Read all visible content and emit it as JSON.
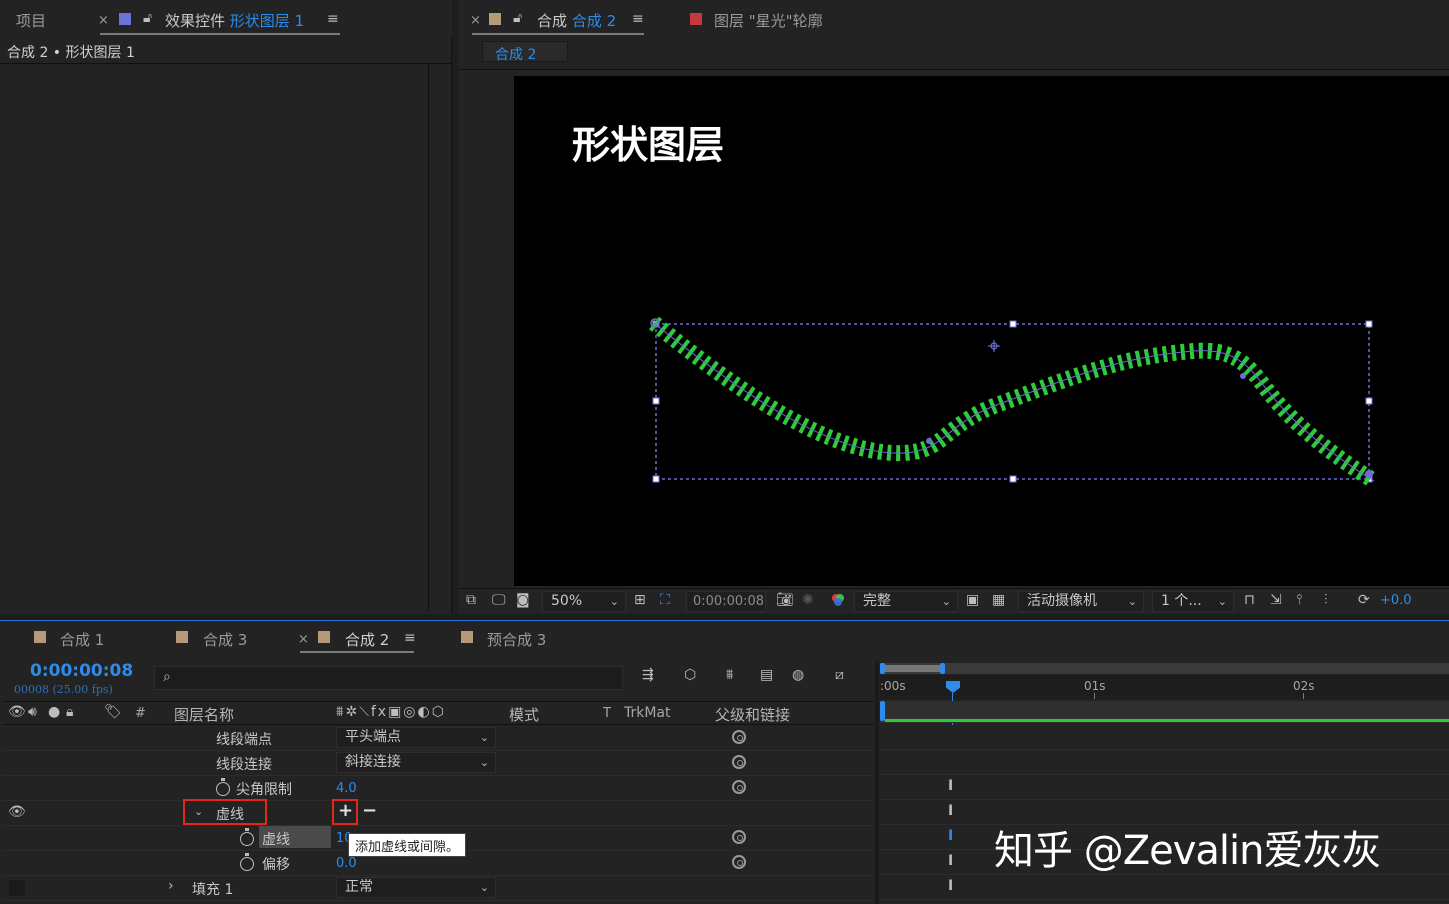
{
  "project_panel": {
    "tab_project": "项目",
    "tab_effects_prefix": "效果控件",
    "tab_effects_layer": "形状图层 1",
    "breadcrumb": "合成 2 • 形状图层 1"
  },
  "viewer_panel": {
    "tab_comp_prefix": "合成",
    "tab_comp_name": "合成 2",
    "tab_layer": "图层 \"星光\"轮廓",
    "sub_tab": "合成 2",
    "canvas_title": "形状图层",
    "toolbar": {
      "zoom": "50%",
      "timecode": "0:00:00:08",
      "resolution": "完整",
      "camera": "活动摄像机",
      "views": "1 个...",
      "exposure": "+0.0"
    }
  },
  "timeline": {
    "tabs": [
      {
        "label": "合成 1",
        "color": "#b59a7a"
      },
      {
        "label": "合成 3",
        "color": "#b59a7a"
      },
      {
        "label": "合成 2",
        "color": "#b59a7a"
      },
      {
        "label": "预合成 3",
        "color": "#b59a7a"
      }
    ],
    "current_time": "0:00:00:08",
    "frame_info": "00008 (25.00 fps)",
    "columns": {
      "hash": "#",
      "layer_name": "图层名称",
      "mode": "模式",
      "t": "T",
      "trkmat": "TrkMat",
      "parent": "父级和链接"
    },
    "ruler": {
      "t0": ":00s",
      "t1": "01s",
      "t2": "02s"
    },
    "rows": {
      "line_cap": {
        "label": "线段端点",
        "value": "平头端点"
      },
      "line_join": {
        "label": "线段连接",
        "value": "斜接连接"
      },
      "miter_limit": {
        "label": "尖角限制",
        "value": "4.0"
      },
      "dashes": {
        "label": "虚线"
      },
      "dash": {
        "label": "虚线",
        "value": "10"
      },
      "offset": {
        "label": "偏移",
        "value": "0.0"
      },
      "fill": {
        "label": "填充 1",
        "value": "正常"
      }
    },
    "tooltip": "添加虚线或间隙。"
  },
  "watermark": "知乎 @Zevalin爱灰灰",
  "colors": {
    "accent_blue": "#2d8ceb",
    "stroke_green": "#2ecb3a",
    "highlight_red": "#e0281e"
  }
}
